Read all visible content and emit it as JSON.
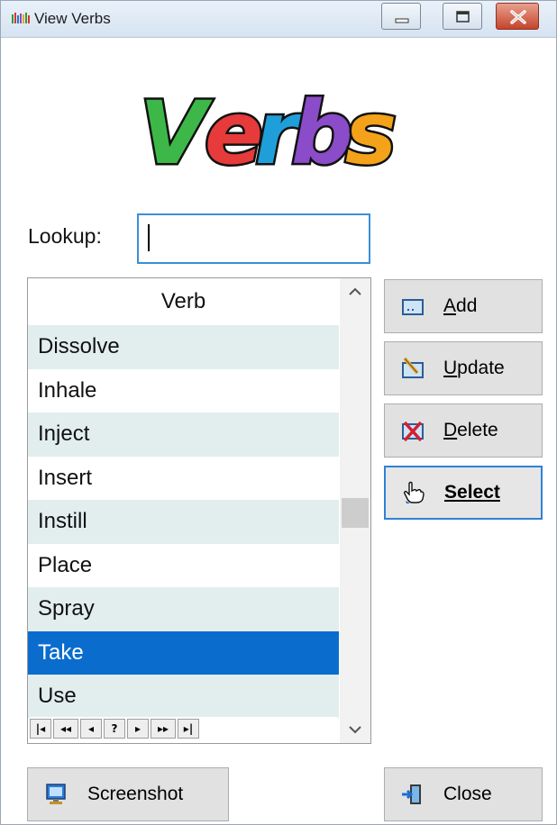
{
  "window": {
    "title": "View Verbs",
    "minimize_label": "",
    "maximize_label": "",
    "close_label": ""
  },
  "logo": {
    "text": "Verbs",
    "letter_colors": [
      "#3db848",
      "#e73a3a",
      "#1f9fd9",
      "#8a4cc8",
      "#f4a21a"
    ]
  },
  "lookup": {
    "label": "Lookup:",
    "value": "",
    "placeholder": ""
  },
  "grid": {
    "column_header": "Verb",
    "rows": [
      "Dissolve",
      "Inhale",
      "Inject",
      "Insert",
      "Instill",
      "Place",
      "Spray",
      "Take",
      "Use"
    ],
    "selected_index": 7,
    "nav_buttons": [
      "first",
      "prev-page",
      "prev",
      "?",
      "next",
      "next-page",
      "last"
    ]
  },
  "buttons": {
    "add": {
      "accel": "A",
      "rest": "dd"
    },
    "update": {
      "accel": "U",
      "rest": "pdate"
    },
    "delete": {
      "accel": "D",
      "rest": "elete"
    },
    "select": {
      "accel": "S",
      "rest": "elect"
    },
    "screenshot": {
      "label": "Screenshot"
    },
    "close": {
      "label": "Close"
    }
  },
  "colors": {
    "accent": "#0a6dce",
    "row_alt": "#e2eeee",
    "focus_border": "#2f82d6"
  }
}
